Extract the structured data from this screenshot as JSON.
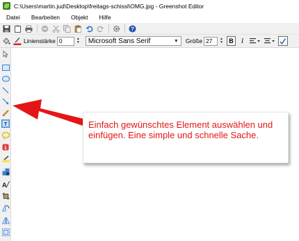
{
  "window": {
    "title": "C:\\Users\\martin.jud\\Desktop\\freitags-schissl\\OMG.jpg - Greenshot Editor"
  },
  "menu": {
    "items": [
      "Datei",
      "Bearbeiten",
      "Objekt",
      "Hilfe"
    ]
  },
  "toolbar": {
    "icons": [
      "save-icon",
      "clipboard-icon",
      "print-icon",
      "delete-icon",
      "cut-icon",
      "copy-icon",
      "paste-icon",
      "undo-icon",
      "redo-icon",
      "settings-icon",
      "help-icon"
    ]
  },
  "properties": {
    "line_width_label": "Linienstärke",
    "line_width_value": "0",
    "font_family": "Microsoft Sans Serif",
    "size_label": "Größe",
    "font_size": "27",
    "bold_label": "B",
    "italic_label": "I",
    "line_color": "#e52020"
  },
  "tools": [
    "select-tool",
    "rectangle-tool",
    "ellipse-tool",
    "line-tool",
    "arrow-tool",
    "freehand-tool",
    "text-tool",
    "speechbubble-tool",
    "counter-tool",
    "highlight-tool",
    "obfuscate-tool",
    "resize-tool",
    "crop-tool",
    "rotate-cw-tool",
    "rotate-ccw-tool",
    "border-tool"
  ],
  "callout": {
    "text": "Einfach gewünschtes Element auswählen und einfügen. Eine simple und schnelle Sache.",
    "color": "#e51515"
  }
}
